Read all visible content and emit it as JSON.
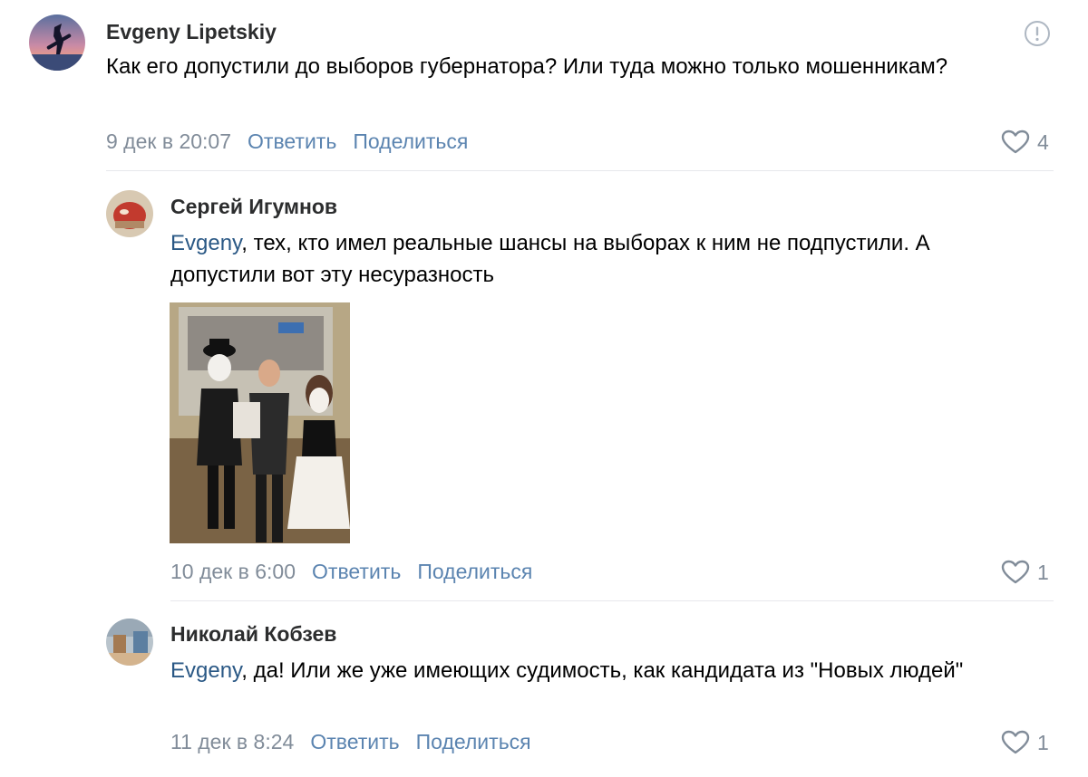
{
  "comments": [
    {
      "author": "Evgeny Lipetskiy",
      "text": "Как его допустили до выборов губернатора? Или туда можно только мошенникам?",
      "date": "9 дек в 20:07",
      "reply_label": "Ответить",
      "share_label": "Поделиться",
      "likes": "4"
    },
    {
      "author": "Сергей Игумнов",
      "mention": "Evgeny",
      "text": ", тех, кто имел реальные шансы на выборах к ним не подпустили. А допустили вот эту несуразность",
      "date": "10 дек в 6:00",
      "reply_label": "Ответить",
      "share_label": "Поделиться",
      "likes": "1"
    },
    {
      "author": "Николай Кобзев",
      "mention": "Evgeny",
      "text": ", да! Или же уже имеющих судимость, как кандидата из \"Новых людей\"",
      "date": "11 дек в 8:24",
      "reply_label": "Ответить",
      "share_label": "Поделиться",
      "likes": "1"
    }
  ],
  "colors": {
    "link": "#5b84b0",
    "mention": "#2a5885",
    "meta": "#818c99",
    "divider": "#e7e8ec"
  },
  "icons": {
    "like": "heart-outline-icon",
    "report": "exclamation-circle-icon"
  }
}
